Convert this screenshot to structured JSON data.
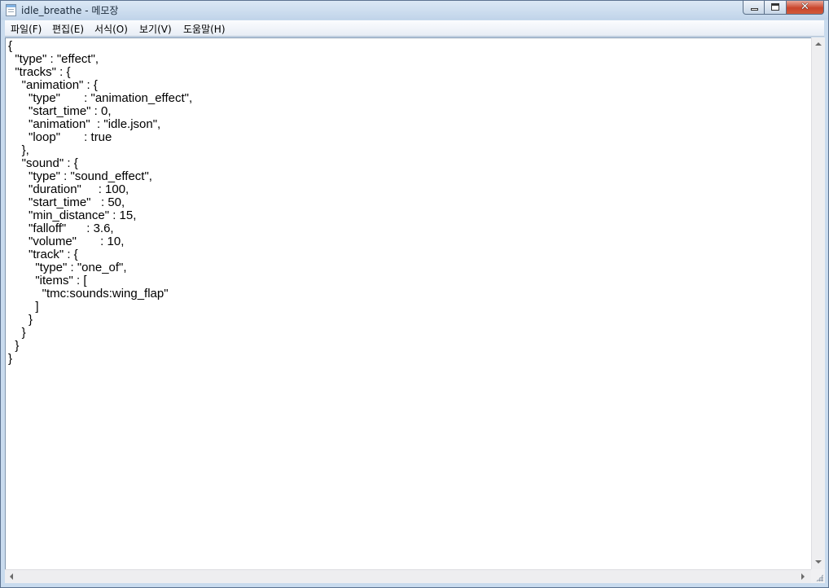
{
  "window": {
    "title": "idle_breathe - 메모장",
    "icon": "notepad-icon",
    "controls": {
      "minimize": "minimize-icon",
      "maximize": "maximize-icon",
      "close": "close-icon",
      "close_glyph": "✕"
    }
  },
  "menu": [
    {
      "label": "파일(F)"
    },
    {
      "label": "편집(E)"
    },
    {
      "label": "서식(O)"
    },
    {
      "label": "보기(V)"
    },
    {
      "label": "도움말(H)"
    }
  ],
  "editor": {
    "content": "{\n  \"type\" : \"effect\",\n  \"tracks\" : {\n    \"animation\" : {\n      \"type\"       : \"animation_effect\",\n      \"start_time\" : 0,\n      \"animation\"  : \"idle.json\",\n      \"loop\"       : true\n    },\n    \"sound\" : {\n      \"type\" : \"sound_effect\",\n      \"duration\"     : 100,\n      \"start_time\"   : 50,\n      \"min_distance\" : 15,\n      \"falloff\"      : 3.6,\n      \"volume\"       : 10,\n      \"track\" : {\n        \"type\" : \"one_of\",\n        \"items\" : [\n          \"tmc:sounds:wing_flap\"\n        ]\n      }\n    }\n  }\n}"
  },
  "colors": {
    "titlebar": "#c2d5ea",
    "close_button": "#c9452c",
    "editor_background": "#ffffff"
  }
}
